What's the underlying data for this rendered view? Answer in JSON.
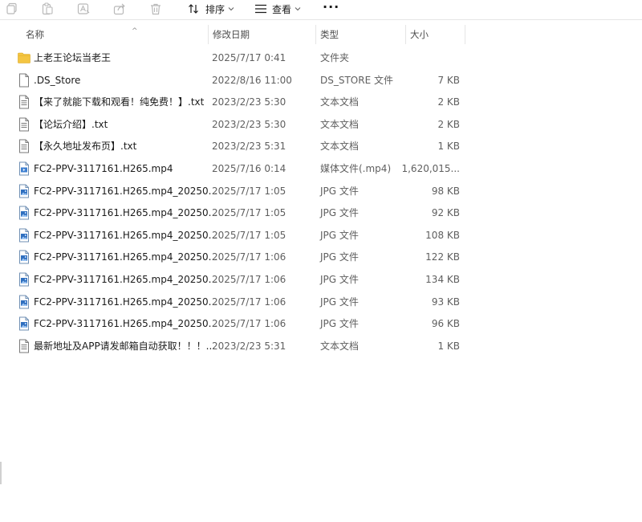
{
  "toolbar": {
    "sort_label": "排序",
    "view_label": "查看",
    "more_label": "···"
  },
  "columns": {
    "name": "名称",
    "date": "修改日期",
    "type": "类型",
    "size": "大小"
  },
  "files": [
    {
      "icon": "folder-icon",
      "name": "上老王论坛当老王",
      "date": "2025/7/17 0:41",
      "type": "文件夹",
      "size": ""
    },
    {
      "icon": "blank-file-icon",
      "name": ".DS_Store",
      "date": "2022/8/16 11:00",
      "type": "DS_STORE 文件",
      "size": "7 KB"
    },
    {
      "icon": "text-file-icon",
      "name": "【来了就能下载和观看！纯免费！】.txt",
      "date": "2023/2/23 5:30",
      "type": "文本文档",
      "size": "2 KB"
    },
    {
      "icon": "text-file-icon",
      "name": "【论坛介绍】.txt",
      "date": "2023/2/23 5:30",
      "type": "文本文档",
      "size": "2 KB"
    },
    {
      "icon": "text-file-icon",
      "name": "【永久地址发布页】.txt",
      "date": "2023/2/23 5:31",
      "type": "文本文档",
      "size": "1 KB"
    },
    {
      "icon": "video-file-icon",
      "name": "FC2-PPV-3117161.H265.mp4",
      "date": "2025/7/16 0:14",
      "type": "媒体文件(.mp4)",
      "size": "1,620,015..."
    },
    {
      "icon": "image-file-icon",
      "name": "FC2-PPV-3117161.H265.mp4_20250...",
      "date": "2025/7/17 1:05",
      "type": "JPG 文件",
      "size": "98 KB"
    },
    {
      "icon": "image-file-icon",
      "name": "FC2-PPV-3117161.H265.mp4_20250...",
      "date": "2025/7/17 1:05",
      "type": "JPG 文件",
      "size": "92 KB"
    },
    {
      "icon": "image-file-icon",
      "name": "FC2-PPV-3117161.H265.mp4_20250...",
      "date": "2025/7/17 1:05",
      "type": "JPG 文件",
      "size": "108 KB"
    },
    {
      "icon": "image-file-icon",
      "name": "FC2-PPV-3117161.H265.mp4_20250...",
      "date": "2025/7/17 1:06",
      "type": "JPG 文件",
      "size": "122 KB"
    },
    {
      "icon": "image-file-icon",
      "name": "FC2-PPV-3117161.H265.mp4_20250...",
      "date": "2025/7/17 1:06",
      "type": "JPG 文件",
      "size": "134 KB"
    },
    {
      "icon": "image-file-icon",
      "name": "FC2-PPV-3117161.H265.mp4_20250...",
      "date": "2025/7/17 1:06",
      "type": "JPG 文件",
      "size": "93 KB"
    },
    {
      "icon": "image-file-icon",
      "name": "FC2-PPV-3117161.H265.mp4_20250...",
      "date": "2025/7/17 1:06",
      "type": "JPG 文件",
      "size": "96 KB"
    },
    {
      "icon": "text-file-icon",
      "name": "最新地址及APP请发邮箱自动获取！！！...",
      "date": "2023/2/23 5:31",
      "type": "文本文档",
      "size": "1 KB"
    }
  ],
  "colors": {
    "folder": "#f4c542",
    "accent": "#1f6fc5",
    "disabled_icon": "#b9b9b9"
  }
}
